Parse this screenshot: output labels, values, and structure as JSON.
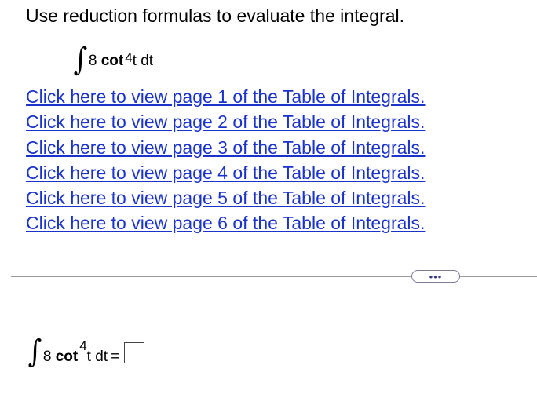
{
  "question": {
    "instruction": "Use reduction formulas to evaluate the integral.",
    "integrand": {
      "integral_sign": "∫",
      "coefficient": "8",
      "function": "cot",
      "exponent": "4",
      "variable": "t",
      "differential": "dt"
    }
  },
  "links": [
    {
      "label": "Click here to view page 1 of the Table of Integrals."
    },
    {
      "label": "Click here to view page 2 of the Table of Integrals."
    },
    {
      "label": "Click here to view page 3 of the Table of Integrals."
    },
    {
      "label": "Click here to view page 4 of the Table of Integrals."
    },
    {
      "label": "Click here to view page 5 of the Table of Integrals."
    },
    {
      "label": "Click here to view page 6 of the Table of Integrals."
    }
  ],
  "divider": {
    "more_label": "•••"
  },
  "answer": {
    "equals": "=",
    "value": ""
  },
  "colors": {
    "link": "#1a33cc",
    "divider": "#9a9a9a",
    "text": "#000000"
  }
}
